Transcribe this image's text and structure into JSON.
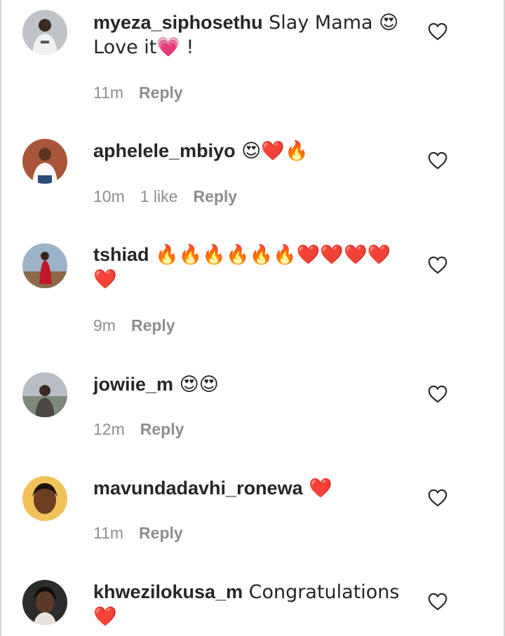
{
  "comments": [
    {
      "username": "myeza_siphosethu",
      "text": " Slay Mama 😍\nLove it💗 !",
      "time": "11m",
      "likes": "",
      "reply_label": "Reply",
      "avatar_icon": "avatar-person-hoodie"
    },
    {
      "username": "aphelele_mbiyo",
      "text": " 😍❤️🔥",
      "time": "10m",
      "likes": "1 like",
      "reply_label": "Reply",
      "avatar_icon": "avatar-person-white-top"
    },
    {
      "username": "tshiad",
      "text": " 🔥🔥🔥🔥🔥🔥❤️❤️❤️❤️\n❤️",
      "time": "9m",
      "likes": "",
      "reply_label": "Reply",
      "avatar_icon": "avatar-person-red-dress"
    },
    {
      "username": "jowiie_m",
      "text": " 😍😍",
      "time": "12m",
      "likes": "",
      "reply_label": "Reply",
      "avatar_icon": "avatar-person-outdoor"
    },
    {
      "username": "mavundadavhi_ronewa",
      "text": " ❤️",
      "time": "11m",
      "likes": "",
      "reply_label": "Reply",
      "avatar_icon": "avatar-person-selfie"
    },
    {
      "username": "khwezilokusa_m",
      "text": " Congratulations\n❤️",
      "time": "",
      "likes": "",
      "reply_label": "",
      "avatar_icon": "avatar-person-dark"
    }
  ],
  "colors": {
    "text": "#262626",
    "meta": "#8e8e8e",
    "background": "#ffffff"
  }
}
